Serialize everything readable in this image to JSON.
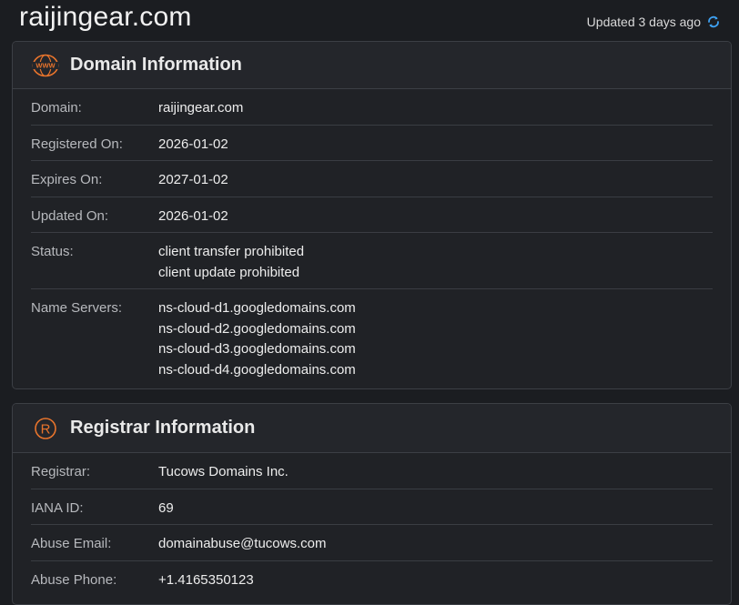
{
  "header": {
    "site_title": "raijingear.com",
    "updated_text": "Updated 3 days ago",
    "refresh_icon": "refresh-icon"
  },
  "colors": {
    "accent_orange": "#e8742c",
    "accent_blue": "#3ea1f2",
    "background": "#1b1d21",
    "card_background": "#202226"
  },
  "domain_info": {
    "title": "Domain Information",
    "icon": "www-globe-icon",
    "rows": {
      "domain": {
        "label": "Domain:",
        "value": "raijingear.com"
      },
      "registered": {
        "label": "Registered On:",
        "value": "2026-01-02"
      },
      "expires": {
        "label": "Expires On:",
        "value": "2027-01-02"
      },
      "updated": {
        "label": "Updated On:",
        "value": "2026-01-02"
      },
      "status": {
        "label": "Status:",
        "values": [
          "client transfer prohibited",
          "client update prohibited"
        ]
      },
      "name_servers": {
        "label": "Name Servers:",
        "values": [
          "ns-cloud-d1.googledomains.com",
          "ns-cloud-d2.googledomains.com",
          "ns-cloud-d3.googledomains.com",
          "ns-cloud-d4.googledomains.com"
        ]
      }
    }
  },
  "registrar_info": {
    "title": "Registrar Information",
    "icon": "registered-icon",
    "rows": {
      "registrar": {
        "label": "Registrar:",
        "value": "Tucows Domains Inc."
      },
      "iana": {
        "label": "IANA ID:",
        "value": "69"
      },
      "abuse_email": {
        "label": "Abuse Email:",
        "value": "domainabuse@tucows.com"
      },
      "abuse_phone": {
        "label": "Abuse Phone:",
        "value": "+1.4165350123"
      }
    }
  }
}
